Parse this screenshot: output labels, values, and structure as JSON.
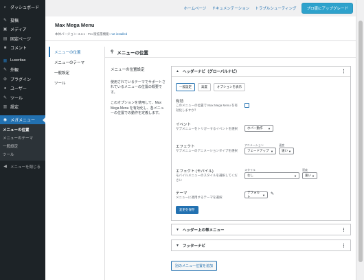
{
  "sidebar": {
    "items": [
      {
        "label": "ダッシュボード",
        "icon": "dashboard-icon",
        "glyph": "◐"
      },
      {
        "label": "投稿",
        "icon": "pin-icon",
        "glyph": "✎"
      },
      {
        "label": "メディア",
        "icon": "media-icon",
        "glyph": "▣"
      },
      {
        "label": "固定ページ",
        "icon": "page-icon",
        "glyph": "▤"
      },
      {
        "label": "コメント",
        "icon": "comment-icon",
        "glyph": "■"
      },
      {
        "label": "Luxeritas",
        "icon": "luxeritas-icon",
        "glyph": "▦"
      },
      {
        "label": "外観",
        "icon": "brush-icon",
        "glyph": "✎"
      },
      {
        "label": "プラグイン",
        "icon": "plugin-icon",
        "glyph": "⚙"
      },
      {
        "label": "ユーザー",
        "icon": "user-icon",
        "glyph": "●"
      },
      {
        "label": "ツール",
        "icon": "tool-icon",
        "glyph": "✎"
      },
      {
        "label": "設定",
        "icon": "settings-icon",
        "glyph": "▥"
      },
      {
        "label": "メガメニュー",
        "icon": "megamenu-icon",
        "glyph": "◉"
      }
    ],
    "submenu": [
      "メニューの位置",
      "メニューのテーマ",
      "一般設定",
      "ツール"
    ],
    "collapse_label": "メニューを閉じる",
    "collapse_glyph": "◀"
  },
  "topbar": {
    "links": [
      "ホームページ",
      "ドキュメンテーション",
      "トラブルシューティング"
    ],
    "pro_button": "プロ版にアップグレード"
  },
  "header": {
    "title": "Max Mega Menu",
    "version_text": "本体バージョン: 3.3.1 · Pro 版拡張機能:",
    "pro_status": "not installed"
  },
  "tabs": [
    "メニューの位置",
    "メニューのテーマ",
    "一般設定",
    "ツール"
  ],
  "section": {
    "title": "メニューの位置",
    "icon_glyph": "⚲"
  },
  "left_col": {
    "heading": "メニューの位置設定",
    "para1": "使用されているテーマでサポートされているメニューの位置の概要です。",
    "para2": "このオプションを使用して、Max Mega Menu を有効化し、各メニューの位置での動作を定義します。"
  },
  "panels": {
    "header_nav": {
      "title": "ヘッダーナビ（グローバルナビ）",
      "subtabs": [
        "一般設定",
        "高度",
        "オプションを表示"
      ],
      "enable": {
        "title": "有効",
        "desc": "このメニューの位置で Max Mega Menu を有効化しますか？"
      },
      "event": {
        "title": "イベント",
        "desc": "サブメニューをトリガーするイベントを選択",
        "value": "ホバー動作"
      },
      "effect": {
        "title": "エフェクト",
        "desc": "サブメニューのアニメーションタイプを選択",
        "anim_label": "アニメーション",
        "anim_value": "フェードアップ",
        "speed_label": "速度",
        "speed_value": "速い"
      },
      "effect_mobile": {
        "title": "エフェクト (モバイル)",
        "desc": "モバイルメニューのスタイルを選択してください",
        "style_label": "スタイル",
        "style_value": "なし",
        "speed_label": "速度",
        "speed_value": "速い"
      },
      "theme": {
        "title": "テーマ",
        "desc": "メニューに適用するテーマを選択",
        "value": "デフォルト"
      },
      "save_button": "変更を保存"
    },
    "header_upper": {
      "title": "ヘッダー上の帯メニュー"
    },
    "footer_nav": {
      "title": "フッターナビ"
    }
  },
  "add_button": "別のメニュー位置を追加",
  "colors": {
    "accent": "#2271b1",
    "sidebar": "#1d2327",
    "pro": "#2ea2cc"
  }
}
